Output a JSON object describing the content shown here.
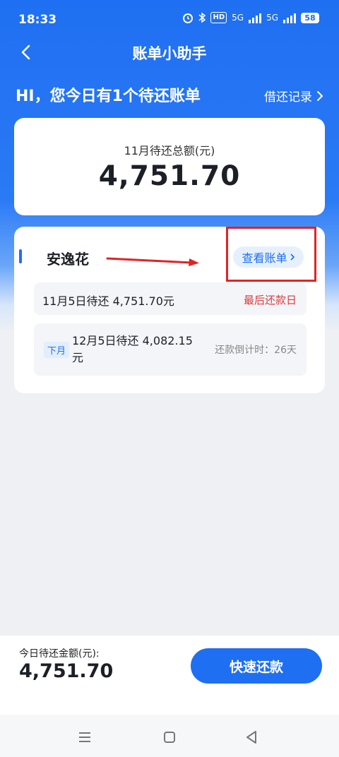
{
  "status": {
    "time": "18:33",
    "hd": "HD",
    "signal1": "5G",
    "signal2": "5G",
    "battery": "58"
  },
  "nav": {
    "title": "账单小助手"
  },
  "greeting": {
    "text": "HI，您今日有1个待还账单",
    "records_link": "借还记录"
  },
  "total": {
    "label": "11月待还总额(元)",
    "amount": "4,751.70"
  },
  "bill": {
    "name": "安逸花",
    "view_button": "查看账单",
    "current": {
      "text": "11月5日待还 4,751.70元",
      "tag": "最后还款日"
    },
    "next": {
      "badge": "下月",
      "text": "12月5日待还 4,082.15元",
      "countdown": "还款倒计时：26天"
    }
  },
  "bottom": {
    "today_label": "今日待还金额(元):",
    "today_amount": "4,751.70",
    "pay_button": "快速还款"
  },
  "colors": {
    "brand": "#1f6ff2",
    "warning": "#d93a3a",
    "annotation": "#e02424"
  }
}
